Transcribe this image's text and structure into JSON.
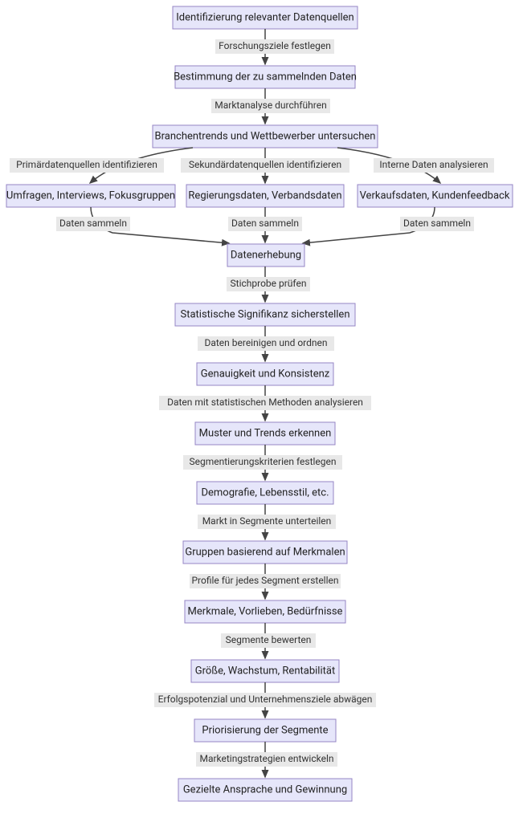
{
  "diagram": {
    "type": "flowchart",
    "nodes": {
      "n1": "Identifizierung relevanter Datenquellen",
      "n2": "Bestimmung der zu sammelnden Daten",
      "n3": "Branchentrends und Wettbewerber untersuchen",
      "n4a": "Umfragen, Interviews, Fokusgruppen",
      "n4b": "Regierungsdaten, Verbandsdaten",
      "n4c": "Verkaufsdaten, Kundenfeedback",
      "n5": "Datenerhebung",
      "n6": "Statistische Signifikanz sicherstellen",
      "n7": "Genauigkeit und Konsistenz",
      "n8": "Muster und Trends erkennen",
      "n9": "Demografie, Lebensstil, etc.",
      "n10": "Gruppen basierend auf Merkmalen",
      "n11": "Merkmale, Vorlieben, Bedürfnisse",
      "n12": "Größe, Wachstum, Rentabilität",
      "n13": "Priorisierung der Segmente",
      "n14": "Gezielte Ansprache und Gewinnung"
    },
    "edges": {
      "e1": "Forschungsziele festlegen",
      "e2": "Marktanalyse durchführen",
      "e3a": "Primärdatenquellen identifizieren",
      "e3b": "Sekundärdatenquellen identifizieren",
      "e3c": "Interne Daten analysieren",
      "e4a": "Daten sammeln",
      "e4b": "Daten sammeln",
      "e4c": "Daten sammeln",
      "e5": "Stichprobe prüfen",
      "e6": "Daten bereinigen und ordnen",
      "e7": "Daten mit statistischen Methoden analysieren",
      "e8": "Segmentierungskriterien festlegen",
      "e9": "Markt in Segmente unterteilen",
      "e10": "Profile für jedes Segment erstellen",
      "e11": "Segmente bewerten",
      "e12": "Erfolgspotenzial und Unternehmensziele abwägen",
      "e13": "Marketingstrategien entwickeln"
    }
  }
}
